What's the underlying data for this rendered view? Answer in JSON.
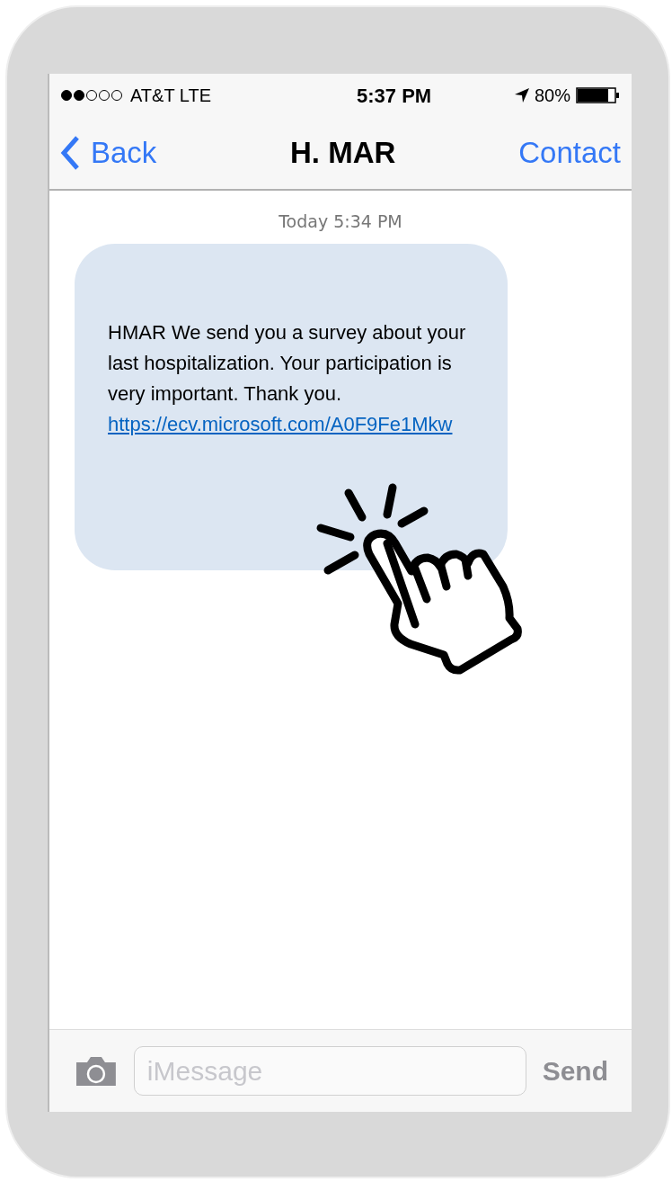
{
  "status_bar": {
    "carrier": "AT&T LTE",
    "time": "5:37 PM",
    "battery": "80%"
  },
  "nav_bar": {
    "back": "Back",
    "title": "H. MAR",
    "action": "Contact"
  },
  "messages": [
    {
      "timestamp": "Today 5:34 PM",
      "text": "HMAR We send you a survey about your last hospitalization. Your participation is very important. Thank you.",
      "link": "https://ecv.microsoft.com/A0F9Fe1Mkw"
    }
  ],
  "composer": {
    "placeholder": "iMessage",
    "send": "Send"
  }
}
